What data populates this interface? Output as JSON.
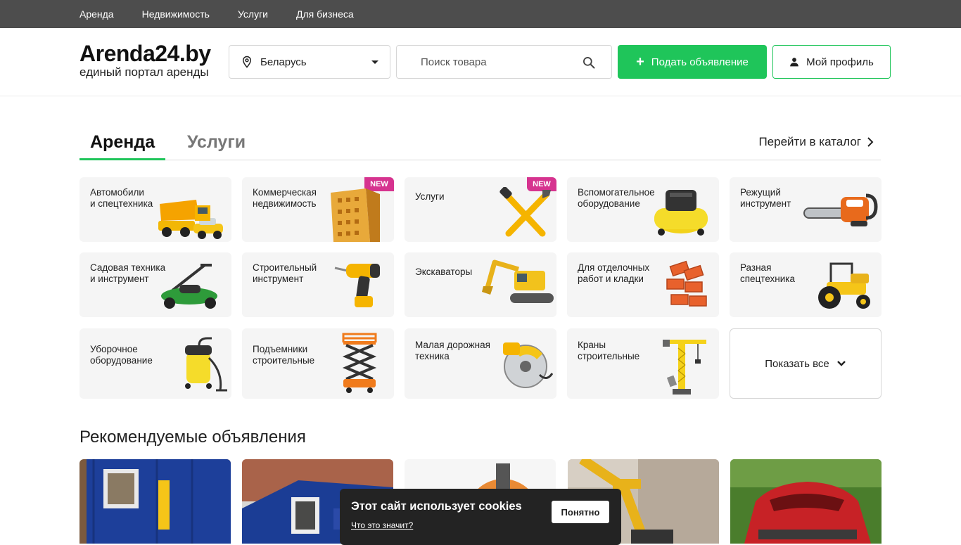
{
  "topnav": {
    "items": [
      "Аренда",
      "Недвижимость",
      "Услуги",
      "Для бизнеса"
    ]
  },
  "header": {
    "logo_name": "Arenda24.by",
    "logo_tagline": "единый портал аренды",
    "region_value": "Беларусь",
    "search_placeholder": "Поиск товара",
    "post_button": "Подать объявление",
    "profile_button": "Мой профиль"
  },
  "tabs": {
    "active": "Аренда",
    "inactive": "Услуги",
    "catalog_link": "Перейти в каталог"
  },
  "categories": [
    {
      "label": "Автомобили\nи спецтехника",
      "badge": "",
      "icon": "dump-truck-icon"
    },
    {
      "label": "Коммерческая\nнедвижимость",
      "badge": "NEW",
      "icon": "building-icon"
    },
    {
      "label": "Услуги",
      "badge": "NEW",
      "icon": "hammer-wrench-icon"
    },
    {
      "label": "Вспомогательное\nоборудование",
      "badge": "",
      "icon": "compressor-icon"
    },
    {
      "label": "Режущий\nинструмент",
      "badge": "",
      "icon": "chainsaw-icon"
    },
    {
      "label": "Садовая техника\nи инструмент",
      "badge": "",
      "icon": "lawn-mower-icon"
    },
    {
      "label": "Строительный\nинструмент",
      "badge": "",
      "icon": "drill-icon"
    },
    {
      "label": "Экскаваторы",
      "badge": "",
      "icon": "excavator-icon"
    },
    {
      "label": "Для отделочных\nработ и кладки",
      "badge": "",
      "icon": "bricks-icon"
    },
    {
      "label": "Разная\nспецтехника",
      "badge": "",
      "icon": "tractor-icon"
    },
    {
      "label": "Уборочное\nоборудование",
      "badge": "",
      "icon": "vacuum-cleaner-icon"
    },
    {
      "label": "Подъемники\nстроительные",
      "badge": "",
      "icon": "scissor-lift-icon"
    },
    {
      "label": "Малая дорожная\nтехника",
      "badge": "",
      "icon": "road-saw-icon"
    },
    {
      "label": "Краны\nстроительные",
      "badge": "",
      "icon": "crane-icon"
    }
  ],
  "show_all": "Показать все",
  "recommended": {
    "title": "Рекомендуемые объявления"
  },
  "cookie": {
    "text": "Этот сайт использует cookies",
    "link": "Что это значит?",
    "button": "Понятно"
  }
}
